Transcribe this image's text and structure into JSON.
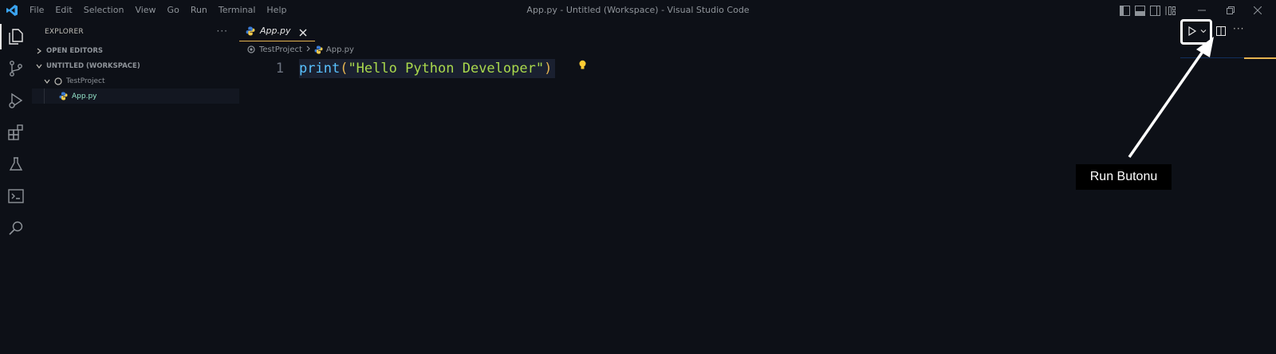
{
  "window": {
    "title": "App.py - Untitled (Workspace) - Visual Studio Code"
  },
  "menu": {
    "items": [
      "File",
      "Edit",
      "Selection",
      "View",
      "Go",
      "Run",
      "Terminal",
      "Help"
    ]
  },
  "activity_bar": {
    "icons": [
      "explorer-icon",
      "source-control-icon",
      "run-debug-icon",
      "extensions-icon",
      "testing-icon",
      "remote-explorer-icon",
      "search-icon"
    ]
  },
  "sidebar": {
    "title": "EXPLORER",
    "more": "···",
    "open_editors": "OPEN EDITORS",
    "workspace": "UNTITLED (WORKSPACE)",
    "project": "TestProject",
    "file": "App.py"
  },
  "editor": {
    "tab_label": "App.py",
    "breadcrumb": [
      "TestProject",
      "App.py"
    ],
    "line_number": "1",
    "code": {
      "fn": "print",
      "open": "(",
      "str": "\"Hello Python Developer\"",
      "close": ")"
    },
    "more": "···"
  },
  "annotation": {
    "label": "Run Butonu"
  },
  "colors": {
    "background": "#0d1017",
    "accent": "#e6b450",
    "function": "#59c2ff",
    "string": "#aad94c"
  }
}
